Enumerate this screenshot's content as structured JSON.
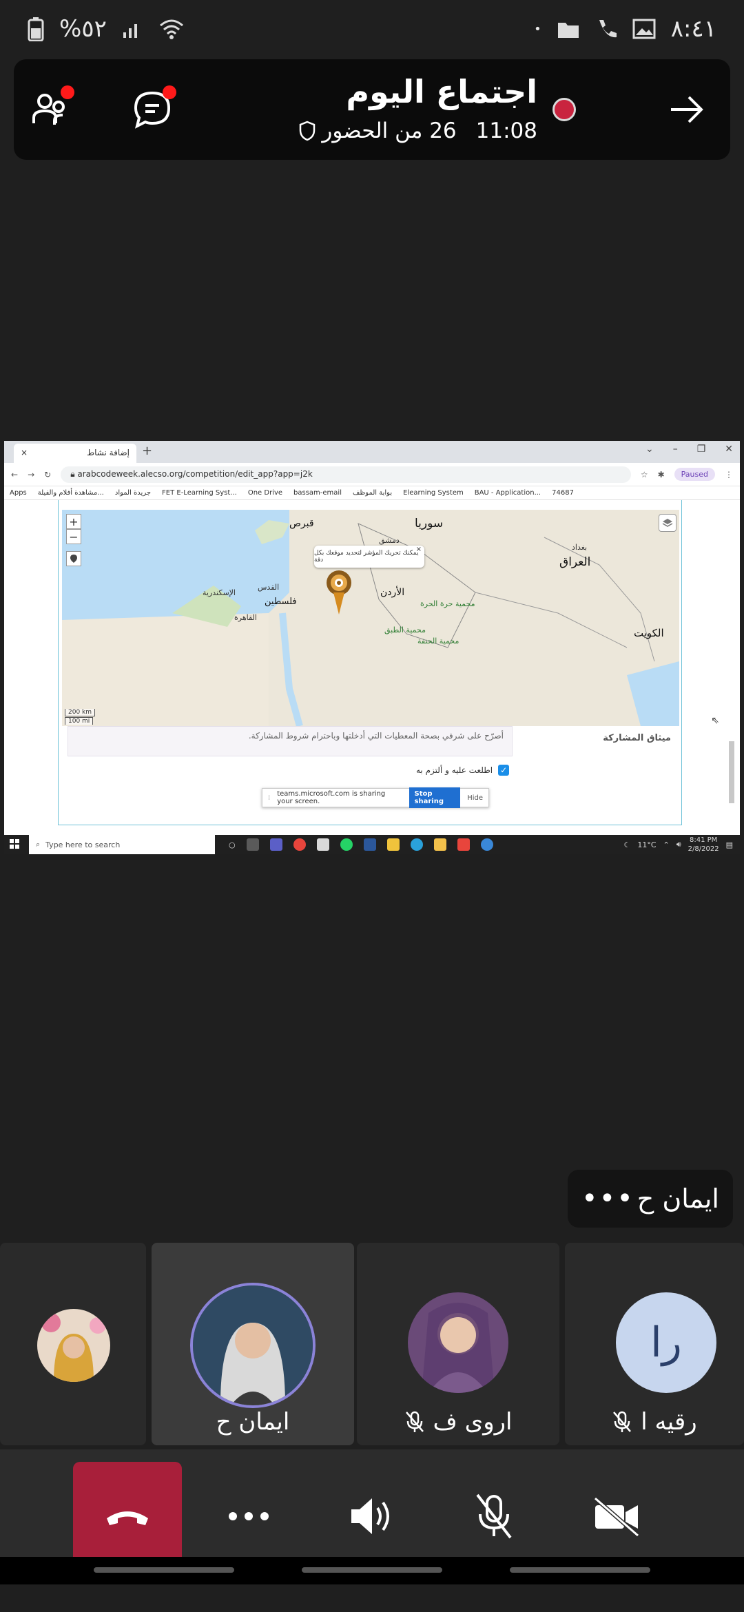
{
  "status_bar": {
    "time": "٨:٤١",
    "battery": "%٥٢"
  },
  "meeting": {
    "title": "اجتماع اليوم",
    "duration": "11:08",
    "attendance": "26 من الحضور"
  },
  "shared_screen": {
    "tab_title": "إضافة نشاط",
    "url": "arabcodeweek.alecso.org/competition/edit_app?app=j2k",
    "profile_status": "Paused",
    "bookmarks": [
      "Apps",
      "مشاهدة أفلام والفيلة...",
      "جريدة المواد",
      "FET E-Learning Syst...",
      "One Drive",
      "bassam-email",
      "بوابة الموظف",
      "Elearning System",
      "BAU - Application...",
      "74687"
    ],
    "map": {
      "countries": [
        "سوريا",
        "العراق",
        "الأردن",
        "فلسطين",
        "قبرص",
        "الكويت"
      ],
      "cities": [
        "القدس",
        "الإسكندرية",
        "القاهرة",
        "بغداد",
        "دمشق"
      ],
      "regions": [
        "محمية حرة الحرة",
        "محمية الطبق",
        "محمية الحنفة"
      ],
      "popup_text": "يمكنك تحريك المؤشر لتحديد موقعك بكل دقة",
      "scale_km": "200 km",
      "scale_mi": "100 mi",
      "zoom_in": "+",
      "zoom_out": "−"
    },
    "charter_label": "ميثاق المشاركة",
    "charter_text": "أصرّح على شرفي بصحة المعطيات التي أدخلتها وباحترام شروط المشاركة.",
    "agree_label": "اطلعت عليه و ألتزم به",
    "sharing_notice": "teams.microsoft.com is sharing your screen.",
    "stop_sharing": "Stop sharing",
    "hide": "Hide",
    "search_placeholder": "Type here to search",
    "weather": "11°C",
    "clock_time": "8:41 PM",
    "clock_date": "2/8/2022"
  },
  "active_speaker": {
    "name": "ايمان ح",
    "more": "•••"
  },
  "participants": [
    {
      "name": "رقيه ا",
      "initials": "را",
      "muted": true
    },
    {
      "name": "اروى ف",
      "muted": true
    },
    {
      "name": "ايمان ح",
      "muted": false,
      "speaking": true
    },
    {
      "name": "",
      "muted": false
    }
  ],
  "colors": {
    "hangup": "#a81f3a",
    "record": "#c9243f",
    "badge": "#ff1a1a",
    "speaking_ring": "#8b83d8"
  }
}
